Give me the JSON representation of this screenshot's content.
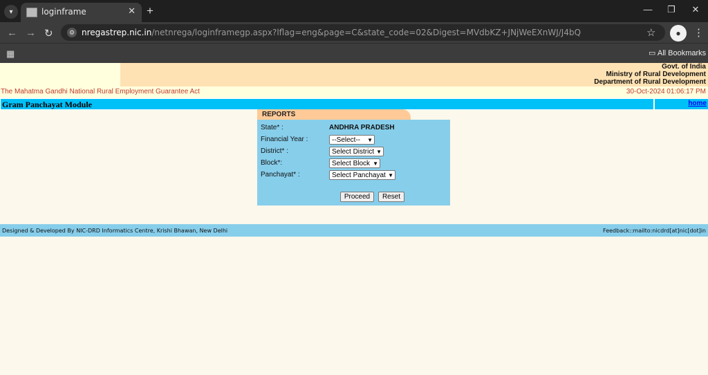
{
  "browser": {
    "tab_title": "loginframe",
    "url_host": "nregastrep.nic.in",
    "url_path": "/netnrega/loginframegp.aspx?lflag=eng&page=C&state_code=02&Digest=MVdbKZ+JNjWeEXnWJ/J4bQ",
    "all_bookmarks": "All Bookmarks"
  },
  "header": {
    "gov_line1": "Govt. of India",
    "gov_line2": "Ministry of Rural Development",
    "gov_line3": "Department of Rural Development",
    "act_title": "The Mahatma Gandhi National Rural Employment Guarantee Act",
    "datetime": "30-Oct-2024 01:06:17 PM"
  },
  "module": {
    "title": "Gram Panchayat Module",
    "home_link": "home"
  },
  "reports": {
    "tab_label": "REPORTS",
    "state_label": "State* :",
    "state_value": "ANDHRA PRADESH",
    "fy_label": "Financial Year :",
    "fy_selected": "--Select--",
    "district_label": "District* :",
    "district_selected": "Select District",
    "block_label": "Block*:",
    "block_selected": "Select Block",
    "panchayat_label": "Panchayat* :",
    "panchayat_selected": "Select Panchayat",
    "proceed_label": "Proceed",
    "reset_label": "Reset"
  },
  "footer": {
    "left": "Designed & Developed By NIC-DRD Informatics Centre, Krishi Bhawan, New Delhi",
    "right": "Feedback::mailto:nicdrd[at]nic[dot]in"
  },
  "colors": {
    "module_bar": "#00c0f8",
    "form_bg": "#87ceeb",
    "header_peach": "#ffe2b3",
    "act_red": "#c0392b"
  }
}
